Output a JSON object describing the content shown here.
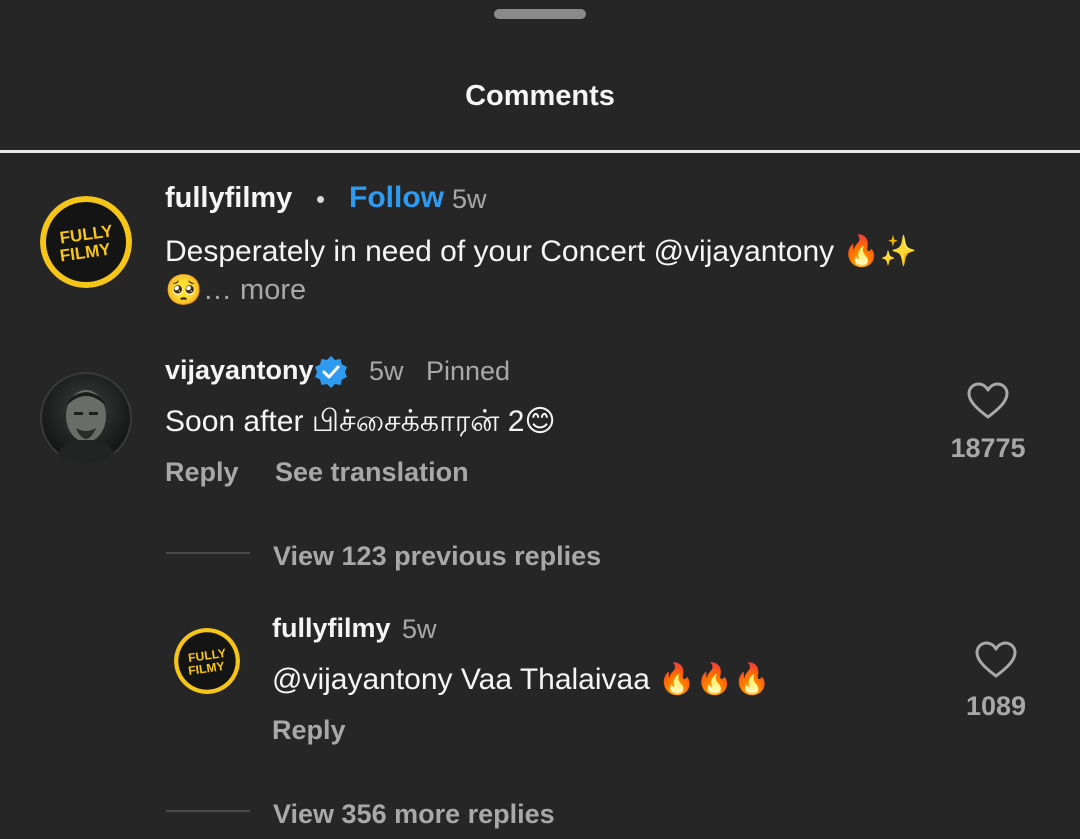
{
  "header": {
    "title": "Comments"
  },
  "comments": [
    {
      "username": "fullyfilmy",
      "follow_label": "Follow",
      "separator": "•",
      "time": "5w",
      "text_line1": "Desperately in need of your Concert @vijayantony 🔥✨",
      "text_line2_emoji": "🥺",
      "more_label": "… more",
      "avatar_icon": "fully-filmy-logo"
    },
    {
      "username": "vijayantony",
      "verified_icon": "verified-badge-icon",
      "time": "5w",
      "pinned_label": "Pinned",
      "text": "Soon after பிச்சைக்காரன் 2😊",
      "reply_label": "Reply",
      "translate_label": "See translation",
      "likes": "18775",
      "avatar_icon": "profile-photo"
    }
  ],
  "view_previous_label": "View 123 previous replies",
  "reply": {
    "username": "fullyfilmy",
    "time": "5w",
    "text": "@vijayantony Vaa Thalaivaa 🔥🔥🔥",
    "reply_label": "Reply",
    "likes": "1089",
    "avatar_icon": "fully-filmy-logo"
  },
  "view_more_label": "View 356 more replies",
  "colors": {
    "background": "#262626",
    "follow": "#2f9bf0",
    "muted": "#a8a8a8",
    "verified": "#2f9bf0",
    "logo_yellow": "#f5c518"
  }
}
